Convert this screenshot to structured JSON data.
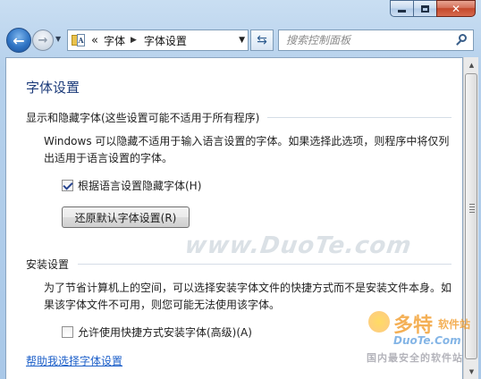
{
  "window": {
    "blurred_title": "",
    "caption": {
      "minimize": "",
      "maximize": "",
      "close": "✕"
    }
  },
  "nav": {
    "back_glyph": "←",
    "forward_glyph": "→",
    "history_glyph": "▼",
    "address_chevron": "«",
    "breadcrumbs": [
      "字体",
      "字体设置"
    ],
    "crumb_separator": "▶",
    "address_dropdown": "▼",
    "refresh_glyph": "⇆",
    "search_placeholder": "搜索控制面板"
  },
  "page": {
    "title": "字体设置",
    "section1": {
      "heading": "显示和隐藏字体(这些设置可能不适用于所有程序)",
      "description": "Windows 可以隐藏不适用于输入语言设置的字体。如果选择此选项，则程序中将仅列出适用于语言设置的字体。",
      "checkbox_label": "根据语言设置隐藏字体(H)",
      "checkbox_checked": true,
      "restore_button": "还原默认字体设置(R)"
    },
    "section2": {
      "heading": "安装设置",
      "description": "为了节省计算机上的空间，可以选择安装字体文件的快捷方式而不是安装文件本身。如果该字体文件不可用，则您可能无法使用该字体。",
      "checkbox_label": "允许使用快捷方式安装字体(高级)(A)",
      "checkbox_checked": false
    },
    "help_link": "帮助我选择字体设置"
  },
  "scrollbar": {
    "up": "▲",
    "down": "▼"
  },
  "watermark": {
    "center": "www.DuoTe.com",
    "logo_big": "多特",
    "logo_small": "软件站",
    "logo_url": "DuoTe.Com",
    "logo_slogan": "国内最安全的软件站"
  },
  "colors": {
    "link": "#1c5fc9",
    "title": "#1c3b7a",
    "frame": "#b6d1ec"
  }
}
